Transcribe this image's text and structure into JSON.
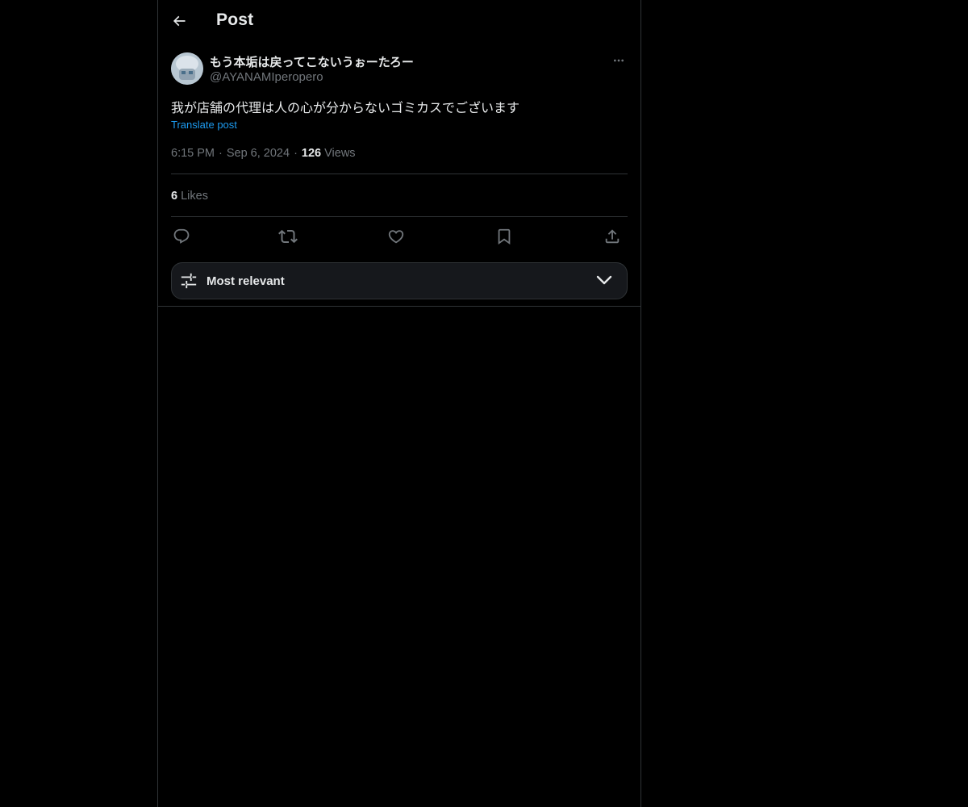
{
  "header": {
    "title": "Post",
    "back_icon": "arrow-left-icon"
  },
  "post": {
    "author": {
      "display_name": "もう本垢は戻ってこないうぉーたろー",
      "handle": "@AYANAMIperopero",
      "avatar_icon": "avatar"
    },
    "text": "我が店舗の代理は人の心が分からないゴミカスでございます",
    "translate_label": "Translate post",
    "time": "6:15 PM",
    "date": "Sep 6, 2024",
    "views_count": "126",
    "views_label": "Views",
    "likes_count": "6",
    "likes_label": "Likes"
  },
  "actions": {
    "reply_icon": "reply-icon",
    "repost_icon": "repost-icon",
    "like_icon": "heart-icon",
    "bookmark_icon": "bookmark-icon",
    "share_icon": "share-icon"
  },
  "sort": {
    "label": "Most relevant"
  },
  "colors": {
    "background": "#000000",
    "text_primary": "#e7e9ea",
    "text_secondary": "#71767b",
    "accent": "#1d9bf0",
    "border": "#2f3336"
  }
}
